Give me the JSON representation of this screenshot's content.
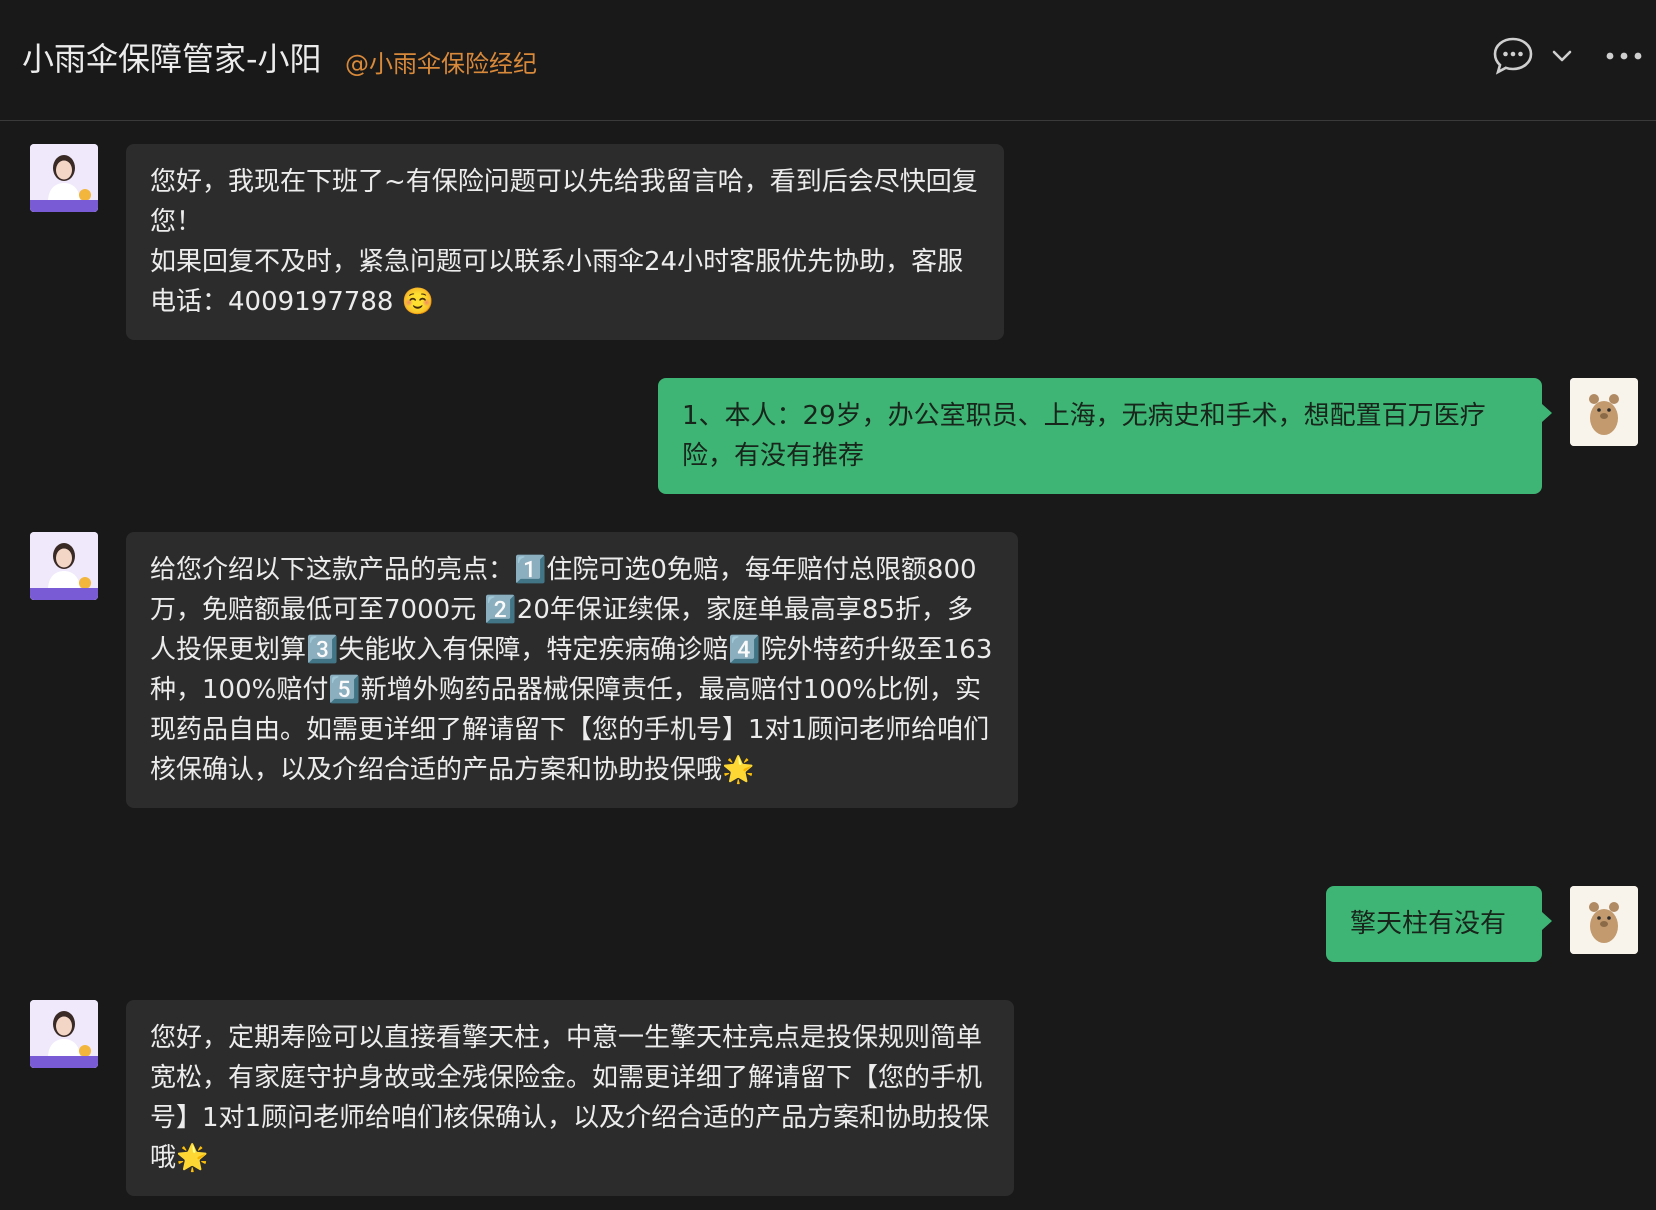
{
  "header": {
    "title": "小雨伞保障管家-小阳",
    "subtitle": "@小雨伞保险经纪",
    "icons": [
      "chat-bubble-icon",
      "chevron-down-icon",
      "more-icon"
    ]
  },
  "colors": {
    "background": "#191919",
    "incoming_bubble": "#2c2c2c",
    "outgoing_bubble": "#3eb575",
    "subtitle": "#d9893a"
  },
  "messages": [
    {
      "sender": "agent",
      "text": "您好，我现在下班了~有保险问题可以先给我留言哈，看到后会尽快回复您！\n如果回复不及时，紧急问题可以联系小雨伞24小时客服优先协助，客服电话：4009197788 ☺️"
    },
    {
      "sender": "user",
      "text": "1、本人：29岁，办公室职员、上海，无病史和手术，想配置百万医疗险，有没有推荐"
    },
    {
      "sender": "agent",
      "text": "给您介绍以下这款产品的亮点：1️⃣住院可选0免赔，每年赔付总限额800万，免赔额最低可至7000元 2️⃣20年保证续保，家庭单最高享85折，多人投保更划算3️⃣失能收入有保障，特定疾病确诊赔4️⃣院外特药升级至163种，100%赔付5️⃣新增外购药品器械保障责任，最高赔付100%比例，实现药品自由。如需更详细了解请留下【您的手机号】1对1顾问老师给咱们核保确认，以及介绍合适的产品方案和协助投保哦🌟"
    },
    {
      "sender": "user",
      "text": "擎天柱有没有"
    },
    {
      "sender": "agent",
      "text": "您好，定期寿险可以直接看擎天柱，中意一生擎天柱亮点是投保规则简单宽松，有家庭守护身故或全残保险金。如需更详细了解请留下【您的手机号】1对1顾问老师给咱们核保确认，以及介绍合适的产品方案和协助投保哦🌟"
    }
  ]
}
